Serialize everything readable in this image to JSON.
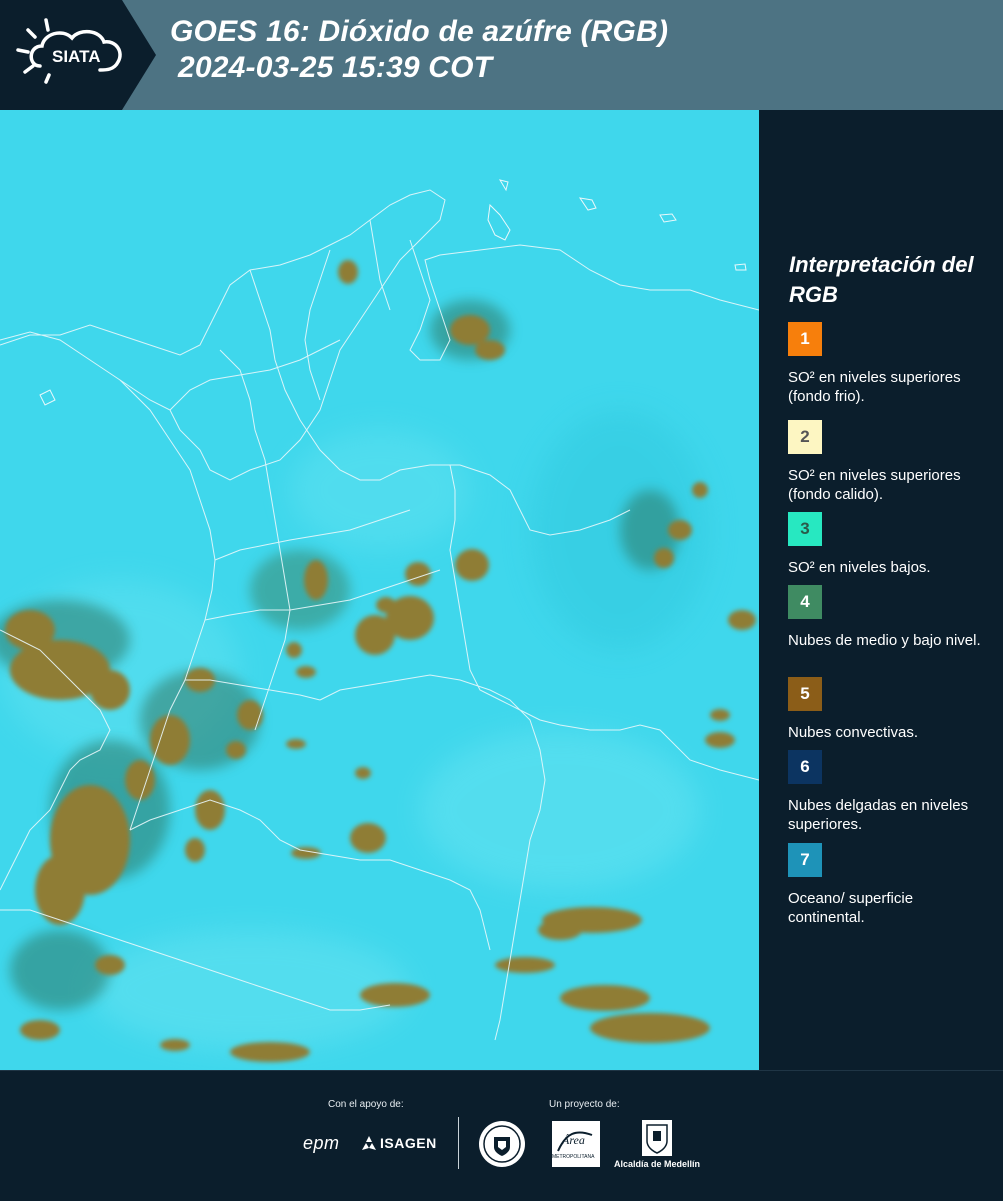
{
  "header": {
    "brand": "SIATA",
    "title_line1": "GOES 16: Dióxido de azúfre (RGB)",
    "title_line2": "2024-03-25 15:39 COT"
  },
  "legend": {
    "title": "Interpretación del RGB",
    "items": [
      {
        "number": "1",
        "text": "SO² en niveles superiores (fondo frio).",
        "color": "#f77f0c",
        "num_color": "#ffffff"
      },
      {
        "number": "2",
        "text": "SO² en niveles superiores (fondo calido).",
        "color": "#fdf6c2",
        "num_color": "#555555"
      },
      {
        "number": "3",
        "text": "SO² en niveles bajos.",
        "color": "#27e8c1",
        "num_color": "#2a5a4a"
      },
      {
        "number": "4",
        "text": "Nubes de medio y bajo nivel.",
        "color": "#3f8b62",
        "num_color": "#ffffff"
      },
      {
        "number": "5",
        "text": "Nubes convectivas.",
        "color": "#8b5d18",
        "num_color": "#ffffff"
      },
      {
        "number": "6",
        "text": "Nubes delgadas en niveles superiores.",
        "color": "#0c3461",
        "num_color": "#ffffff"
      },
      {
        "number": "7",
        "text": "Oceano/ superficie continental.",
        "color": "#1e93b8",
        "num_color": "#ffffff"
      }
    ]
  },
  "footer": {
    "support_label": "Con el apoyo de:",
    "project_label": "Un proyecto de:",
    "sponsor1": "epm",
    "sponsor2": "ISAGEN",
    "area_metro": "Área",
    "area_sub": "METROPOLITANA",
    "alcaldia": "Alcaldía de Medellín"
  },
  "colors": {
    "header_bg": "#4d7383",
    "panel_bg": "#0b1e2c",
    "land_cyan": "#3dd8ec",
    "cloud_olive": "#8f7d34"
  }
}
